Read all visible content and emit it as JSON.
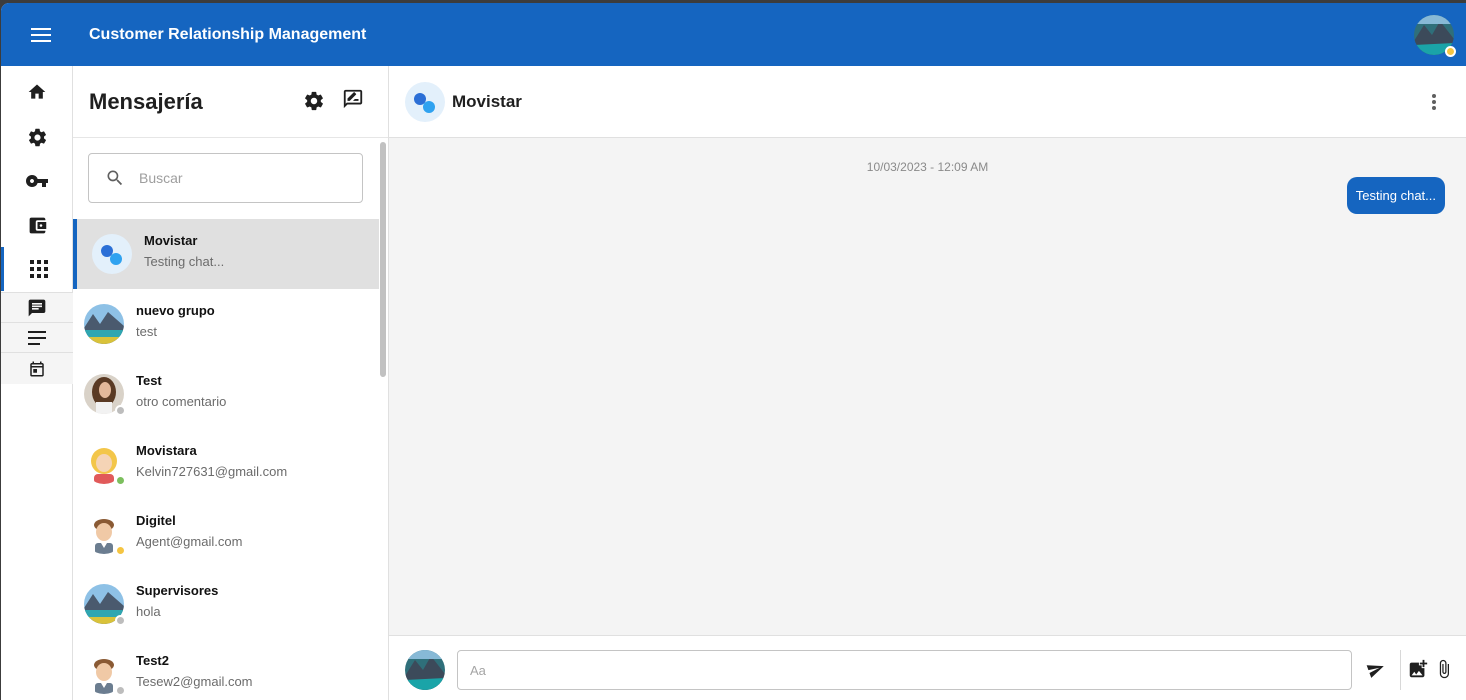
{
  "app": {
    "title": "Customer Relationship Management"
  },
  "colors": {
    "primary": "#1565c0",
    "active_row": "#e0e0e0",
    "chat_bg": "#f4f4f4",
    "status_away": "#f5c542",
    "status_online": "#7cbf5e",
    "status_offline": "#bdbdbd"
  },
  "rail": {
    "items": [
      {
        "icon": "home-icon"
      },
      {
        "icon": "gear-icon"
      },
      {
        "icon": "key-icon"
      },
      {
        "icon": "wallet-icon"
      },
      {
        "icon": "apps-grid-icon"
      },
      {
        "icon": "chat-icon"
      },
      {
        "icon": "list-lines-icon"
      },
      {
        "icon": "calendar-icon"
      }
    ]
  },
  "panel": {
    "title": "Mensajería",
    "search_placeholder": "Buscar",
    "conversations": [
      {
        "name": "Movistar",
        "preview": "Testing chat...",
        "avatar": "group-chat-avatar",
        "active": true
      },
      {
        "name": "nuevo grupo",
        "preview": "test",
        "avatar": "landscape-avatar"
      },
      {
        "name": "Test",
        "preview": "otro comentario",
        "avatar": "woman-photo-avatar",
        "status": "offline"
      },
      {
        "name": "Movistara",
        "preview": "Kelvin727631@gmail.com",
        "avatar": "blonde-avatar",
        "status": "online"
      },
      {
        "name": "Digitel",
        "preview": "Agent@gmail.com",
        "avatar": "man-cartoon-avatar",
        "status": "away"
      },
      {
        "name": "Supervisores",
        "preview": "hola",
        "avatar": "landscape-avatar",
        "status": "offline"
      },
      {
        "name": "Test2",
        "preview": "Tesew2@gmail.com",
        "avatar": "man-cartoon-avatar",
        "status": "offline"
      }
    ]
  },
  "chat": {
    "name": "Movistar",
    "date": "10/03/2023 - 12:09 AM",
    "messages": [
      {
        "text": "Testing chat...",
        "own": true
      }
    ],
    "input_placeholder": "Aa"
  }
}
